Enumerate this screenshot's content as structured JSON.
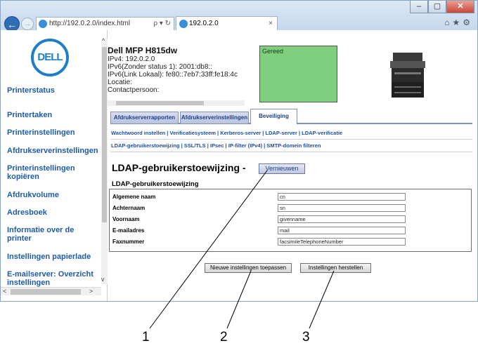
{
  "browser": {
    "address": "http://192.0.2.0/index.html",
    "address_controls": "ρ ▾ ↻",
    "tab_title": "192.0.2.0",
    "tab_close": "×",
    "window_buttons": [
      "–",
      "▢",
      "✕"
    ]
  },
  "sidebar": {
    "logo": "DELL",
    "items": [
      "Printerstatus",
      "Printertaken",
      "Printerinstellingen",
      "Afdrukserverinstellingen",
      "Printerinstellingen kopiëren",
      "Afdrukvolume",
      "Adresboek",
      "Informatie over de printer",
      "Instellingen papierlade",
      "E-mailserver: Overzicht instellingen"
    ]
  },
  "device": {
    "name": "Dell MFP H815dw",
    "lines": [
      "IPv4: 192.0.2.0",
      "IPv6(Zonder status 1): 2001:db8::",
      "IPv6(Link Lokaal): fe80::7eb7:33ff:fe18:4c",
      "Locatie:",
      "Contactpersoon:"
    ],
    "status": "Gereed"
  },
  "tabs": [
    "Afdrukserverrapporten",
    "Afdrukserverinstellingen",
    "Beveiliging"
  ],
  "sublinks_row1": "Wachtwoord instellen | Verificatiesysteem | Kerberos-server | LDAP-server | LDAP-verificatie",
  "sublinks_row2": "LDAP-gebruikerstoewijzing | SSL/TLS | IPsec | IP-filter (IPv4) | SMTP-domein filteren",
  "page": {
    "title": "LDAP-gebruikerstoewijzing -",
    "refresh_label": "Vernieuwen",
    "section_title": "LDAP-gebruikerstoewijzing"
  },
  "form": [
    {
      "label": "Algemene naam",
      "value": "cn"
    },
    {
      "label": "Achternaam",
      "value": "sn"
    },
    {
      "label": "Voornaam",
      "value": "givenname"
    },
    {
      "label": "E-mailadres",
      "value": "mail"
    },
    {
      "label": "Faxnummer",
      "value": "facsimileTelephoneNumber"
    }
  ],
  "buttons": {
    "apply": "Nieuwe instellingen toepassen",
    "restore": "Instellingen herstellen"
  },
  "callouts": [
    "1",
    "2",
    "3"
  ]
}
